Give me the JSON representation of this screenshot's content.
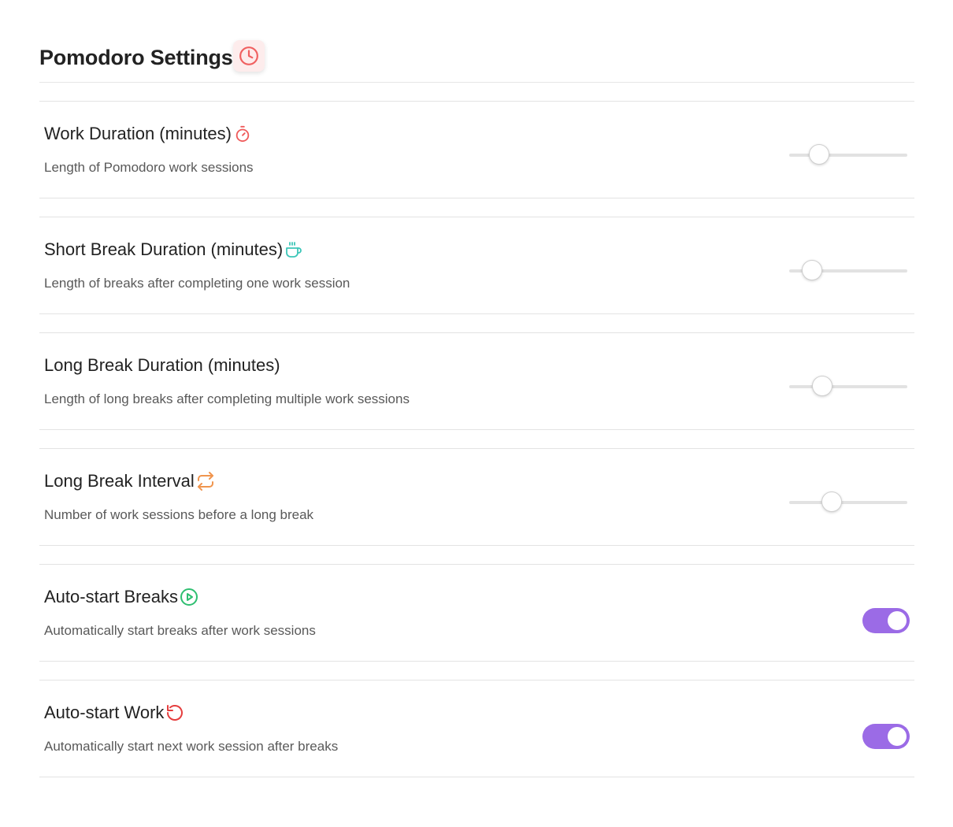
{
  "header": {
    "title": "Pomodoro Settings",
    "icon": "clock-icon",
    "icon_color": "#f06060"
  },
  "settings": [
    {
      "label": "Work Duration (minutes)",
      "description": "Length of Pomodoro work sessions",
      "icon": "stopwatch-icon",
      "icon_color": "#ef5b5b",
      "control": "slider",
      "value_fraction": 0.25
    },
    {
      "label": "Short Break Duration (minutes)",
      "description": "Length of breaks after completing one work session",
      "icon": "coffee-cup-icon",
      "icon_color": "#3cc6b8",
      "control": "slider",
      "value_fraction": 0.19
    },
    {
      "label": "Long Break Duration (minutes)",
      "description": "Length of long breaks after completing multiple work sessions",
      "icon": "",
      "control": "slider",
      "value_fraction": 0.28
    },
    {
      "label": "Long Break Interval",
      "description": "Number of work sessions before a long break",
      "icon": "repeat-icon",
      "icon_color": "#f0954e",
      "control": "slider",
      "value_fraction": 0.36
    },
    {
      "label": "Auto-start Breaks",
      "description": "Automatically start breaks after work sessions",
      "icon": "play-circle-icon",
      "icon_color": "#2fbf71",
      "control": "toggle",
      "enabled": true
    },
    {
      "label": "Auto-start Work",
      "description": "Automatically start next work session after breaks",
      "icon": "restart-icon",
      "icon_color": "#e53e3e",
      "control": "toggle",
      "enabled": true
    }
  ],
  "colors": {
    "accent": "#9b6be6",
    "slider_track": "#e2e2e2",
    "divider": "#e3e3e3"
  }
}
